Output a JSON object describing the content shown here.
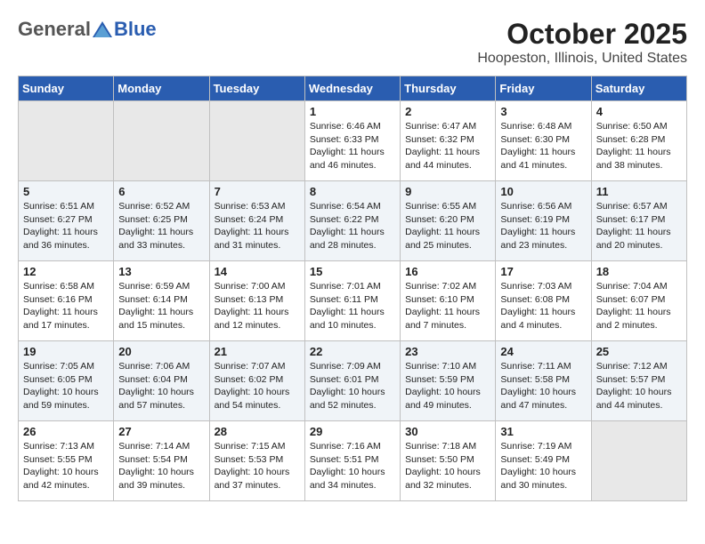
{
  "logo": {
    "general": "General",
    "blue": "Blue"
  },
  "title": "October 2025",
  "subtitle": "Hoopeston, Illinois, United States",
  "days_of_week": [
    "Sunday",
    "Monday",
    "Tuesday",
    "Wednesday",
    "Thursday",
    "Friday",
    "Saturday"
  ],
  "weeks": [
    [
      {
        "day": "",
        "info": ""
      },
      {
        "day": "",
        "info": ""
      },
      {
        "day": "",
        "info": ""
      },
      {
        "day": "1",
        "info": "Sunrise: 6:46 AM\nSunset: 6:33 PM\nDaylight: 11 hours and 46 minutes."
      },
      {
        "day": "2",
        "info": "Sunrise: 6:47 AM\nSunset: 6:32 PM\nDaylight: 11 hours and 44 minutes."
      },
      {
        "day": "3",
        "info": "Sunrise: 6:48 AM\nSunset: 6:30 PM\nDaylight: 11 hours and 41 minutes."
      },
      {
        "day": "4",
        "info": "Sunrise: 6:50 AM\nSunset: 6:28 PM\nDaylight: 11 hours and 38 minutes."
      }
    ],
    [
      {
        "day": "5",
        "info": "Sunrise: 6:51 AM\nSunset: 6:27 PM\nDaylight: 11 hours and 36 minutes."
      },
      {
        "day": "6",
        "info": "Sunrise: 6:52 AM\nSunset: 6:25 PM\nDaylight: 11 hours and 33 minutes."
      },
      {
        "day": "7",
        "info": "Sunrise: 6:53 AM\nSunset: 6:24 PM\nDaylight: 11 hours and 31 minutes."
      },
      {
        "day": "8",
        "info": "Sunrise: 6:54 AM\nSunset: 6:22 PM\nDaylight: 11 hours and 28 minutes."
      },
      {
        "day": "9",
        "info": "Sunrise: 6:55 AM\nSunset: 6:20 PM\nDaylight: 11 hours and 25 minutes."
      },
      {
        "day": "10",
        "info": "Sunrise: 6:56 AM\nSunset: 6:19 PM\nDaylight: 11 hours and 23 minutes."
      },
      {
        "day": "11",
        "info": "Sunrise: 6:57 AM\nSunset: 6:17 PM\nDaylight: 11 hours and 20 minutes."
      }
    ],
    [
      {
        "day": "12",
        "info": "Sunrise: 6:58 AM\nSunset: 6:16 PM\nDaylight: 11 hours and 17 minutes."
      },
      {
        "day": "13",
        "info": "Sunrise: 6:59 AM\nSunset: 6:14 PM\nDaylight: 11 hours and 15 minutes."
      },
      {
        "day": "14",
        "info": "Sunrise: 7:00 AM\nSunset: 6:13 PM\nDaylight: 11 hours and 12 minutes."
      },
      {
        "day": "15",
        "info": "Sunrise: 7:01 AM\nSunset: 6:11 PM\nDaylight: 11 hours and 10 minutes."
      },
      {
        "day": "16",
        "info": "Sunrise: 7:02 AM\nSunset: 6:10 PM\nDaylight: 11 hours and 7 minutes."
      },
      {
        "day": "17",
        "info": "Sunrise: 7:03 AM\nSunset: 6:08 PM\nDaylight: 11 hours and 4 minutes."
      },
      {
        "day": "18",
        "info": "Sunrise: 7:04 AM\nSunset: 6:07 PM\nDaylight: 11 hours and 2 minutes."
      }
    ],
    [
      {
        "day": "19",
        "info": "Sunrise: 7:05 AM\nSunset: 6:05 PM\nDaylight: 10 hours and 59 minutes."
      },
      {
        "day": "20",
        "info": "Sunrise: 7:06 AM\nSunset: 6:04 PM\nDaylight: 10 hours and 57 minutes."
      },
      {
        "day": "21",
        "info": "Sunrise: 7:07 AM\nSunset: 6:02 PM\nDaylight: 10 hours and 54 minutes."
      },
      {
        "day": "22",
        "info": "Sunrise: 7:09 AM\nSunset: 6:01 PM\nDaylight: 10 hours and 52 minutes."
      },
      {
        "day": "23",
        "info": "Sunrise: 7:10 AM\nSunset: 5:59 PM\nDaylight: 10 hours and 49 minutes."
      },
      {
        "day": "24",
        "info": "Sunrise: 7:11 AM\nSunset: 5:58 PM\nDaylight: 10 hours and 47 minutes."
      },
      {
        "day": "25",
        "info": "Sunrise: 7:12 AM\nSunset: 5:57 PM\nDaylight: 10 hours and 44 minutes."
      }
    ],
    [
      {
        "day": "26",
        "info": "Sunrise: 7:13 AM\nSunset: 5:55 PM\nDaylight: 10 hours and 42 minutes."
      },
      {
        "day": "27",
        "info": "Sunrise: 7:14 AM\nSunset: 5:54 PM\nDaylight: 10 hours and 39 minutes."
      },
      {
        "day": "28",
        "info": "Sunrise: 7:15 AM\nSunset: 5:53 PM\nDaylight: 10 hours and 37 minutes."
      },
      {
        "day": "29",
        "info": "Sunrise: 7:16 AM\nSunset: 5:51 PM\nDaylight: 10 hours and 34 minutes."
      },
      {
        "day": "30",
        "info": "Sunrise: 7:18 AM\nSunset: 5:50 PM\nDaylight: 10 hours and 32 minutes."
      },
      {
        "day": "31",
        "info": "Sunrise: 7:19 AM\nSunset: 5:49 PM\nDaylight: 10 hours and 30 minutes."
      },
      {
        "day": "",
        "info": ""
      }
    ]
  ]
}
